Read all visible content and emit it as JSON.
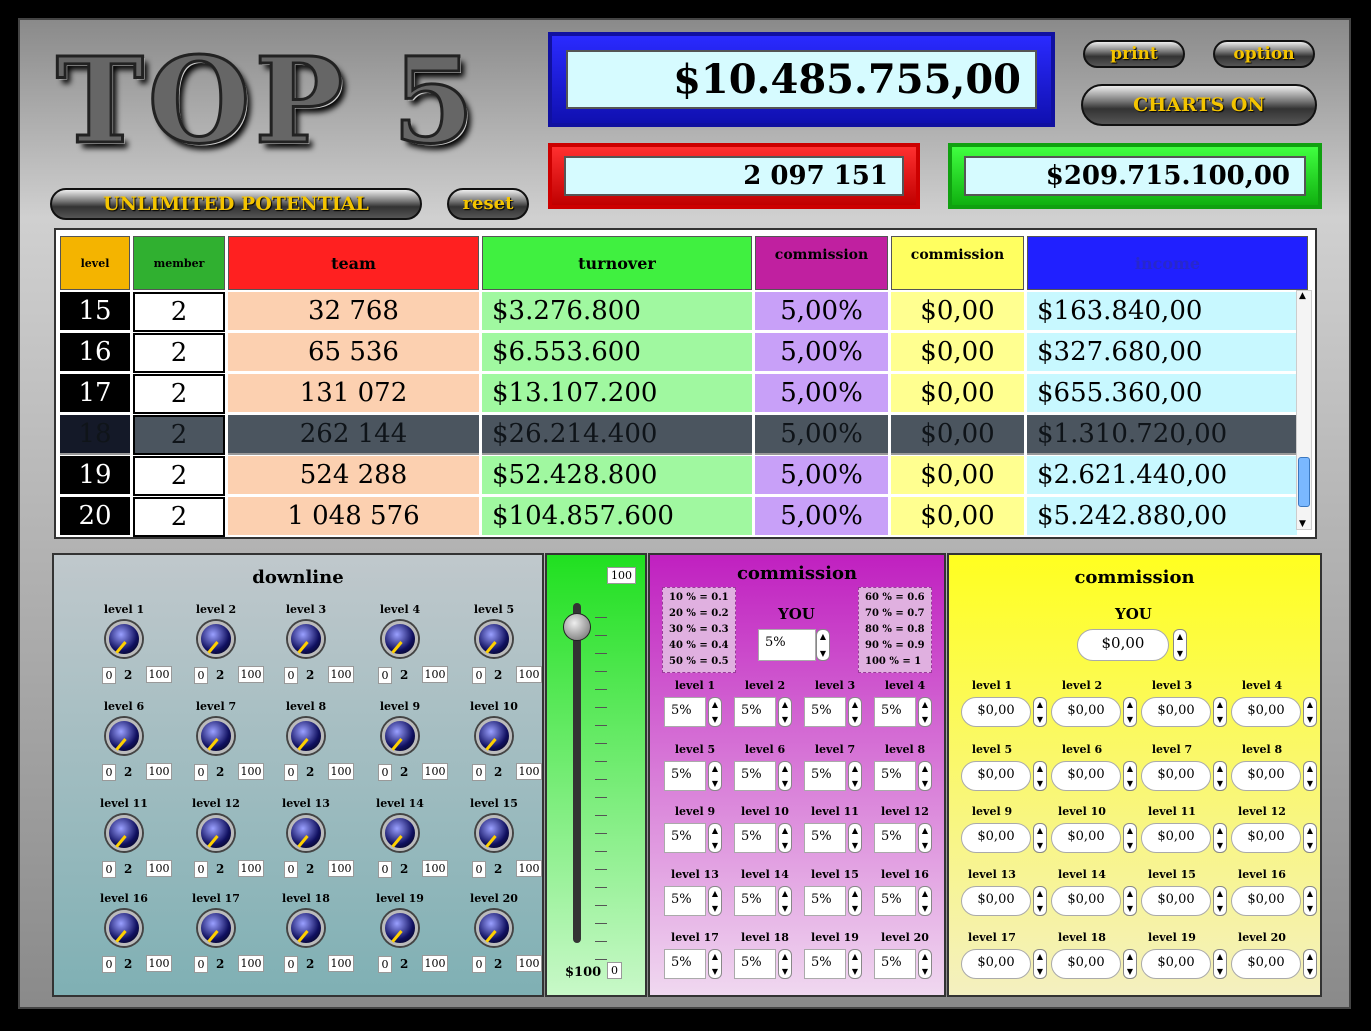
{
  "logo": "TOP 5",
  "buttons": {
    "tagline": "UNLIMITED POTENTIAL",
    "reset": "reset",
    "print": "print",
    "option": "option",
    "charts": "CHARTS ON"
  },
  "totals": {
    "income": "$10.485.755,00",
    "team": "2 097 151",
    "turnover": "$209.715.100,00"
  },
  "table": {
    "headers": [
      "level",
      "member",
      "team",
      "turnover",
      "commission",
      "commission",
      "income"
    ],
    "rows": [
      {
        "level": "15",
        "member": "2",
        "team": "32 768",
        "turnover": "$3.276.800",
        "pct": "5,00%",
        "comm": "$0,00",
        "income": "$163.840,00"
      },
      {
        "level": "16",
        "member": "2",
        "team": "65 536",
        "turnover": "$6.553.600",
        "pct": "5,00%",
        "comm": "$0,00",
        "income": "$327.680,00"
      },
      {
        "level": "17",
        "member": "2",
        "team": "131 072",
        "turnover": "$13.107.200",
        "pct": "5,00%",
        "comm": "$0,00",
        "income": "$655.360,00"
      },
      {
        "level": "18",
        "member": "2",
        "team": "262 144",
        "turnover": "$26.214.400",
        "pct": "5,00%",
        "comm": "$0,00",
        "income": "$1.310.720,00"
      },
      {
        "level": "19",
        "member": "2",
        "team": "524 288",
        "turnover": "$52.428.800",
        "pct": "5,00%",
        "comm": "$0,00",
        "income": "$2.621.440,00"
      },
      {
        "level": "20",
        "member": "2",
        "team": "1 048 576",
        "turnover": "$104.857.600",
        "pct": "5,00%",
        "comm": "$0,00",
        "income": "$5.242.880,00"
      }
    ],
    "selected_row": "18"
  },
  "downline": {
    "title": "downline",
    "levels": [
      "level 1",
      "level 2",
      "level 3",
      "level 4",
      "level 5",
      "level 6",
      "level 7",
      "level 8",
      "level 9",
      "level 10",
      "level 11",
      "level 12",
      "level 13",
      "level 14",
      "level 15",
      "level 16",
      "level 17",
      "level 18",
      "level 19",
      "level 20"
    ],
    "min": "0",
    "value": "2",
    "max": "100"
  },
  "slider": {
    "max": "100",
    "label": "$100",
    "min": "0",
    "fraction": 1.0
  },
  "commission_pct": {
    "title": "commission",
    "you_label": "YOU",
    "you_value": "5%",
    "legend_left": [
      "10 % = 0.1",
      "20 % = 0.2",
      "30 % = 0.3",
      "40 % = 0.4",
      "50 % = 0.5"
    ],
    "legend_right": [
      "60 % = 0.6",
      "70 % = 0.7",
      "80 % = 0.8",
      "90 % = 0.9",
      "100 % = 1"
    ],
    "level_value": "5%"
  },
  "commission_amt": {
    "title": "commission",
    "you_label": "YOU",
    "you_value": "$0,00",
    "level_value": "$0,00"
  },
  "colors": {
    "level": "#f4b400",
    "member": "#30b030",
    "team": "#ff2020",
    "turnover": "#40f040",
    "commission_pct": "#c020a0",
    "commission": "#ffff60",
    "income": "#2020ff"
  }
}
